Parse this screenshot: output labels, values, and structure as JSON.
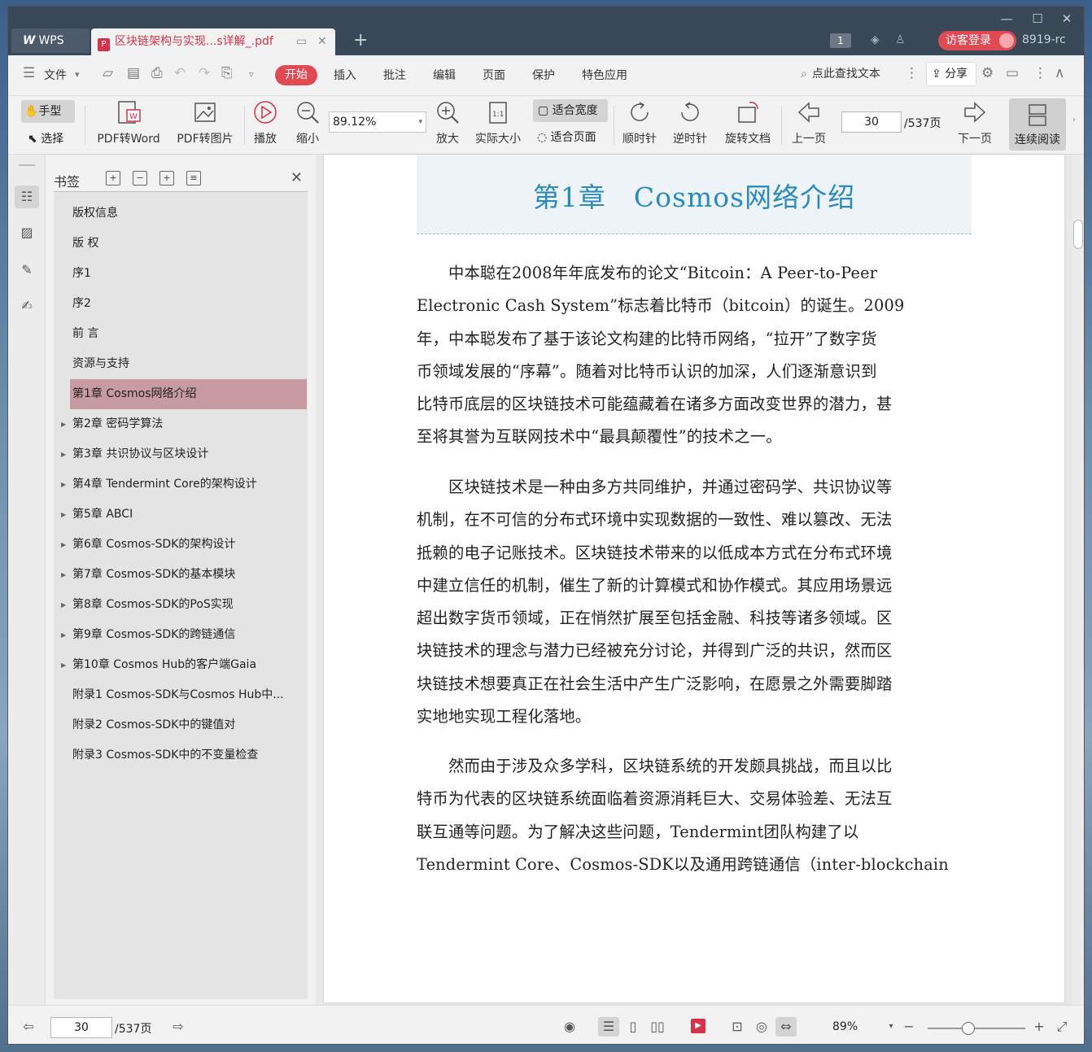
{
  "titlebar": {
    "app_tab": "WPS",
    "doc_tab": "区块链架构与实现...s详解_.pdf",
    "page_badge": "1",
    "login_label": "访客登录",
    "user_id": "8919-rc"
  },
  "menu": {
    "file": "文件",
    "tabs": [
      "开始",
      "插入",
      "批注",
      "编辑",
      "页面",
      "保护",
      "特色应用"
    ],
    "search": "点此查找文本",
    "share": "分享"
  },
  "toolbar": {
    "hand": "手型",
    "select": "选择",
    "pdf_to_word": "PDF转Word",
    "pdf_to_image": "PDF转图片",
    "play": "播放",
    "zoom_out": "缩小",
    "zoom_value": "89.12%",
    "zoom_in": "放大",
    "actual_size": "实际大小",
    "fit_width": "适合宽度",
    "fit_page": "适合页面",
    "clockwise": "顺时针",
    "counter_clockwise": "逆时针",
    "rotate_doc": "旋转文档",
    "prev_page": "上一页",
    "current_page": "30",
    "total_pages": "/537页",
    "next_page": "下一页",
    "continuous_read": "连续阅读"
  },
  "bookmarks": {
    "title": "书签",
    "items": [
      {
        "label": "版权信息",
        "expandable": false,
        "active": false
      },
      {
        "label": "版 权",
        "expandable": false,
        "active": false
      },
      {
        "label": "序1",
        "expandable": false,
        "active": false
      },
      {
        "label": "序2",
        "expandable": false,
        "active": false
      },
      {
        "label": "前 言",
        "expandable": false,
        "active": false
      },
      {
        "label": "资源与支持",
        "expandable": false,
        "active": false
      },
      {
        "label": "第1章 Cosmos网络介绍",
        "expandable": true,
        "active": true
      },
      {
        "label": "第2章 密码学算法",
        "expandable": true,
        "active": false
      },
      {
        "label": "第3章 共识协议与区块设计",
        "expandable": true,
        "active": false
      },
      {
        "label": "第4章 Tendermint Core的架构设计",
        "expandable": true,
        "active": false
      },
      {
        "label": "第5章 ABCI",
        "expandable": true,
        "active": false
      },
      {
        "label": "第6章 Cosmos-SDK的架构设计",
        "expandable": true,
        "active": false
      },
      {
        "label": "第7章 Cosmos-SDK的基本模块",
        "expandable": true,
        "active": false
      },
      {
        "label": "第8章 Cosmos-SDK的PoS实现",
        "expandable": true,
        "active": false
      },
      {
        "label": "第9章 Cosmos-SDK的跨链通信",
        "expandable": true,
        "active": false
      },
      {
        "label": "第10章 Cosmos Hub的客户端Gaia",
        "expandable": true,
        "active": false
      },
      {
        "label": "附录1 Cosmos-SDK与Cosmos Hub中...",
        "expandable": false,
        "active": false
      },
      {
        "label": "附录2 Cosmos-SDK中的键值对",
        "expandable": false,
        "active": false
      },
      {
        "label": "附录3 Cosmos-SDK中的不变量检查",
        "expandable": false,
        "active": false
      }
    ]
  },
  "document": {
    "chapter_title": "第1章　Cosmos网络介绍",
    "paragraphs": [
      [
        "　　中本聪在2008年年底发布的论文“Bitcoin：A Peer-to-Peer",
        "Electronic Cash System”标志着比特币（bitcoin）的诞生。2009",
        "年，中本聪发布了基于该论文构建的比特币网络，“拉开”了数字货",
        "币领域发展的“序幕”。随着对比特币认识的加深，人们逐渐意识到",
        "比特币底层的区块链技术可能蕴藏着在诸多方面改变世界的潜力，甚",
        "至将其誉为互联网技术中“最具颠覆性”的技术之一。"
      ],
      [
        "　　区块链技术是一种由多方共同维护，并通过密码学、共识协议等",
        "机制，在不可信的分布式环境中实现数据的一致性、难以篡改、无法",
        "抵赖的电子记账技术。区块链技术带来的以低成本方式在分布式环境",
        "中建立信任的机制，催生了新的计算模式和协作模式。其应用场景远",
        "超出数字货币领域，正在悄然扩展至包括金融、科技等诸多领域。区",
        "块链技术的理念与潜力已经被充分讨论，并得到广泛的共识，然而区",
        "块链技术想要真正在社会生活中产生广泛影响，在愿景之外需要脚踏",
        "实地地实现工程化落地。"
      ],
      [
        "　　然而由于涉及众多学科，区块链系统的开发颇具挑战，而且以比",
        "特币为代表的区块链系统面临着资源消耗巨大、交易体验差、无法互",
        "联互通等问题。为了解决这些问题，Tendermint团队构建了以",
        "Tendermint Core、Cosmos-SDK以及通用跨链通信（inter-blockchain"
      ]
    ]
  },
  "statusbar": {
    "current_page": "30",
    "total_pages": "/537页",
    "zoom": "89%",
    "zoom_fraction": 0.42
  },
  "colors": {
    "accent": "#e04a54",
    "titlebar": "#394856",
    "chapter_title": "#2a8bbf",
    "active_bookmark": "#c89aa2"
  }
}
